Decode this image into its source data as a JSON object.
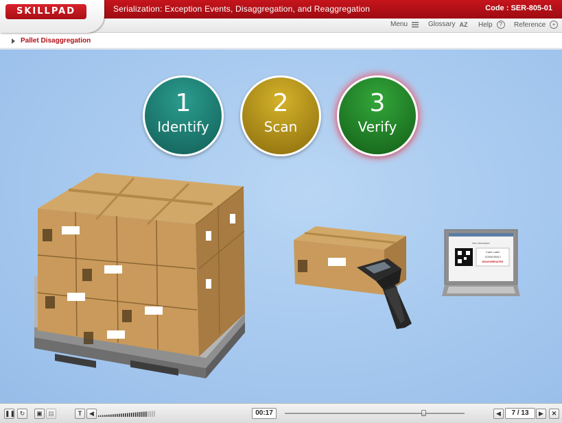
{
  "app": {
    "logo_text": "SKILLPAD",
    "course_title": "Serialization: Exception Events, Disaggregation, and Reaggregation",
    "code_label": "Code :",
    "code_value": "SER-805-01"
  },
  "toolbar": {
    "menu_label": "Menu",
    "glossary_label": "Glossary",
    "glossary_icon_text": "AZ",
    "help_label": "Help",
    "help_icon_text": "?",
    "reference_label": "Reference",
    "reference_icon_text": "+"
  },
  "breadcrumb": {
    "label": "Pallet Disaggregation"
  },
  "steps": [
    {
      "number": "1",
      "label": "Identify",
      "color": "#1f7f74"
    },
    {
      "number": "2",
      "label": "Scan",
      "color": "#b39419"
    },
    {
      "number": "3",
      "label": "Verify",
      "color": "#23862a",
      "active": true
    }
  ],
  "monitor_screen": {
    "header": "Item Information",
    "case_label": "Case Label",
    "serial": "123456789012",
    "status": "DISAGGREGATED"
  },
  "player": {
    "time": "00:17",
    "progress": 0.77,
    "volume": 0.85,
    "page_current": "7",
    "page_separator": "/",
    "page_total": "13",
    "pause_icon": "pause-icon",
    "replay_icon": "replay-icon",
    "text_button": "T"
  },
  "colors": {
    "brand_red": "#b3121a",
    "crumb_text": "#b01018",
    "stage_bg": "#a8c9ef"
  }
}
